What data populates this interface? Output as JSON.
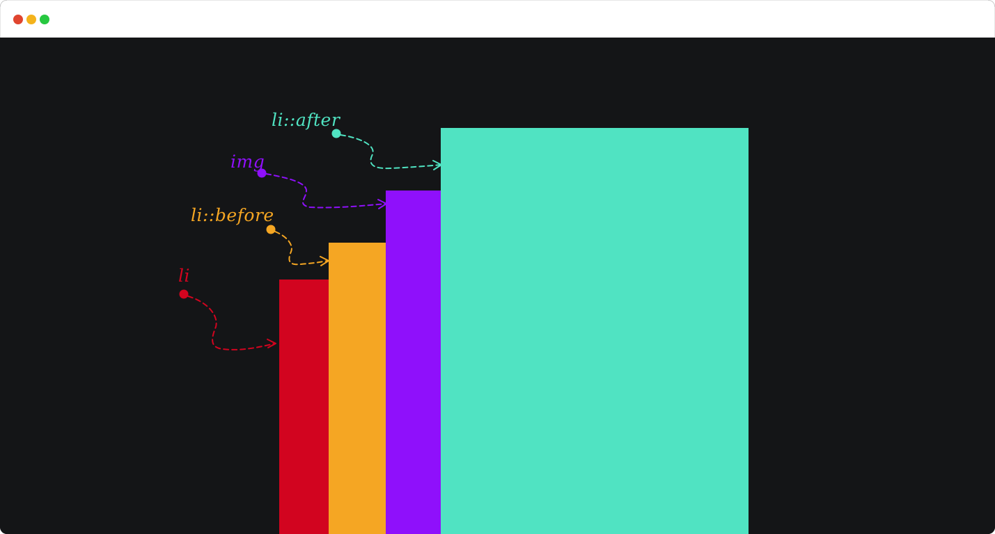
{
  "window": {
    "traffic_lights": [
      {
        "name": "close",
        "color": "#e0452f"
      },
      {
        "name": "minimize",
        "color": "#f4b31c"
      },
      {
        "name": "maximize",
        "color": "#27c840"
      }
    ],
    "background": "#141517"
  },
  "diagram": {
    "layers": [
      {
        "id": "li",
        "label": "li",
        "color": "#d2041f"
      },
      {
        "id": "li-before",
        "label": "li::before",
        "color": "#f5a623"
      },
      {
        "id": "img",
        "label": "img",
        "color": "#8f10fb"
      },
      {
        "id": "li-after",
        "label": "li::after",
        "color": "#50e3c2"
      }
    ]
  }
}
